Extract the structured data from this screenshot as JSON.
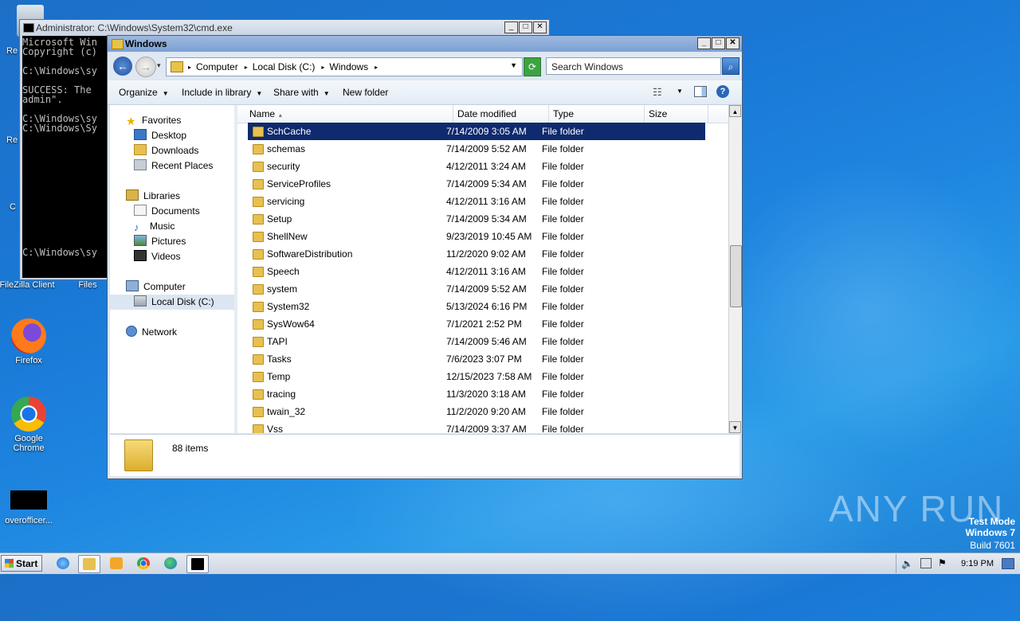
{
  "desktop": {
    "icons": [
      {
        "label": "FileZilla Client",
        "icon": "filezilla-icon"
      },
      {
        "label": "Files",
        "icon": "files-icon"
      },
      {
        "label": "Firefox",
        "icon": "firefox-icon"
      },
      {
        "label": "Google Chrome",
        "icon": "chrome-icon"
      },
      {
        "label": "overofficer...",
        "icon": "file-icon"
      }
    ],
    "partial_labels": [
      "Re",
      "Re",
      "C"
    ]
  },
  "cmd": {
    "title": "Administrator: C:\\Windows\\System32\\cmd.exe",
    "lines": "Microsoft Win\nCopyright (c)\n\nC:\\Windows\\sy\n\nSUCCESS: The\nadmin\".\n\nC:\\Windows\\sy\nC:\\Windows\\Sy\n\n\n\n\n\n\n\n\n\n\n\n\nC:\\Windows\\sy"
  },
  "explorer": {
    "title": "Windows",
    "breadcrumb": [
      "Computer",
      "Local Disk (C:)",
      "Windows"
    ],
    "search_placeholder": "Search Windows",
    "toolbar": {
      "organize": "Organize",
      "include": "Include in library",
      "share": "Share with",
      "new_folder": "New folder"
    },
    "nav": {
      "favorites": "Favorites",
      "desktop": "Desktop",
      "downloads": "Downloads",
      "recent": "Recent Places",
      "libraries": "Libraries",
      "documents": "Documents",
      "music": "Music",
      "pictures": "Pictures",
      "videos": "Videos",
      "computer": "Computer",
      "local_disk": "Local Disk (C:)",
      "network": "Network"
    },
    "columns": {
      "name": "Name",
      "date": "Date modified",
      "type": "Type",
      "size": "Size"
    },
    "rows": [
      {
        "name": "SchCache",
        "date": "7/14/2009 3:05 AM",
        "type": "File folder",
        "selected": true
      },
      {
        "name": "schemas",
        "date": "7/14/2009 5:52 AM",
        "type": "File folder"
      },
      {
        "name": "security",
        "date": "4/12/2011 3:24 AM",
        "type": "File folder"
      },
      {
        "name": "ServiceProfiles",
        "date": "7/14/2009 5:34 AM",
        "type": "File folder"
      },
      {
        "name": "servicing",
        "date": "4/12/2011 3:16 AM",
        "type": "File folder"
      },
      {
        "name": "Setup",
        "date": "7/14/2009 5:34 AM",
        "type": "File folder"
      },
      {
        "name": "ShellNew",
        "date": "9/23/2019 10:45 AM",
        "type": "File folder"
      },
      {
        "name": "SoftwareDistribution",
        "date": "11/2/2020 9:02 AM",
        "type": "File folder"
      },
      {
        "name": "Speech",
        "date": "4/12/2011 3:16 AM",
        "type": "File folder"
      },
      {
        "name": "system",
        "date": "7/14/2009 5:52 AM",
        "type": "File folder"
      },
      {
        "name": "System32",
        "date": "5/13/2024 6:16 PM",
        "type": "File folder"
      },
      {
        "name": "SysWow64",
        "date": "7/1/2021 2:52 PM",
        "type": "File folder",
        "shortcut": true
      },
      {
        "name": "TAPI",
        "date": "7/14/2009 5:46 AM",
        "type": "File folder"
      },
      {
        "name": "Tasks",
        "date": "7/6/2023 3:07 PM",
        "type": "File folder"
      },
      {
        "name": "Temp",
        "date": "12/15/2023 7:58 AM",
        "type": "File folder"
      },
      {
        "name": "tracing",
        "date": "11/3/2020 3:18 AM",
        "type": "File folder"
      },
      {
        "name": "twain_32",
        "date": "11/2/2020 9:20 AM",
        "type": "File folder"
      },
      {
        "name": "Vss",
        "date": "7/14/2009 3:37 AM",
        "type": "File folder"
      }
    ],
    "status": "88 items"
  },
  "watermark": {
    "brand": "ANY RUN",
    "mode": "Test Mode",
    "os": "Windows 7",
    "build": "Build 7601"
  },
  "taskbar": {
    "start": "Start",
    "clock": "9:19 PM"
  }
}
